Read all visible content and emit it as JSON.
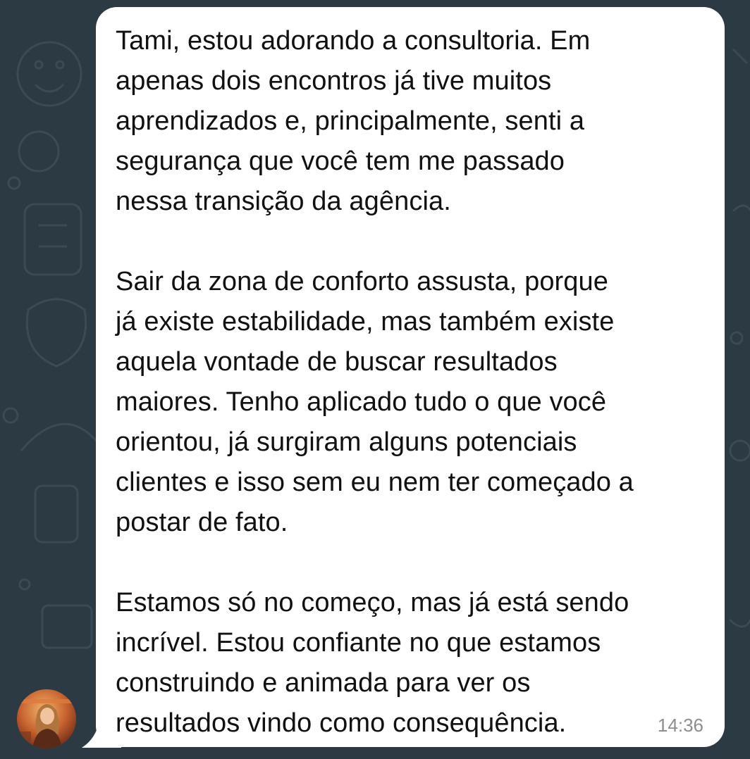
{
  "chat": {
    "message": {
      "text": "Tami, estou adorando a consultoria. Em\napenas dois encontros já tive muitos\naprendizados e, principalmente, senti a\nsegurança que você tem me passado\nnessa transição da agência.\n\nSair da zona de conforto assusta, porque\njá existe estabilidade, mas também existe\naquela vontade de buscar resultados\nmaiores. Tenho aplicado tudo o que você\norientou, já surgiram alguns potenciais\nclientes e isso sem eu nem ter começado a\npostar de fato.\n\nEstamos só no começo, mas já está sendo\nincrível. Estou confiante no que estamos\nconstruindo e animada para ver os\nresultados vindo como consequência.",
      "time": "14:36"
    },
    "avatar_icon": "sender-avatar-photo"
  },
  "colors": {
    "background": "#2c3a44",
    "bubble": "#ffffff",
    "text": "#111111",
    "timestamp": "#8d8d8d"
  }
}
